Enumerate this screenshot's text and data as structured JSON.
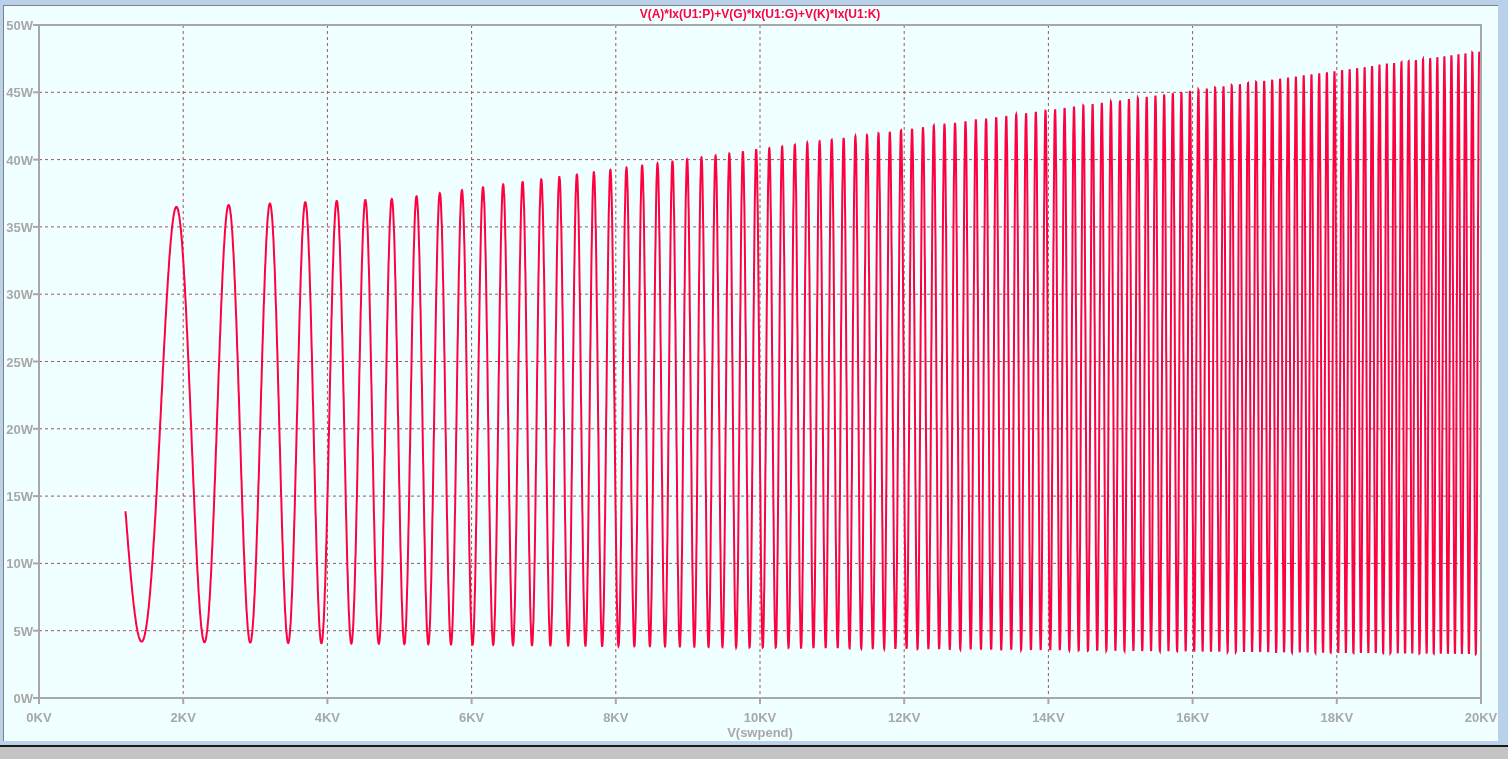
{
  "plot": {
    "trace_label": "V(A)*Ix(U1:P)+V(G)*Ix(U1:G)+V(K)*Ix(U1:K)",
    "y_ticks": [
      "50W",
      "45W",
      "40W",
      "35W",
      "30W",
      "25W",
      "20W",
      "15W",
      "10W",
      "5W",
      "0W"
    ],
    "x_ticks": [
      "0KV",
      "2KV",
      "4KV",
      "6KV",
      "8KV",
      "10KV",
      "12KV",
      "14KV",
      "16KV",
      "18KV",
      "20KV"
    ],
    "x_axis_label": "V(swpend)"
  }
}
